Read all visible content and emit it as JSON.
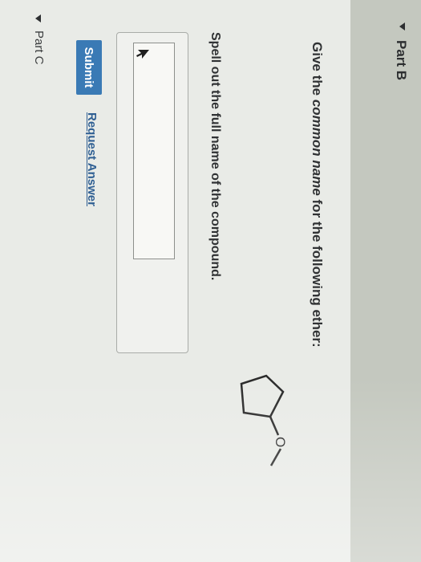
{
  "part_b": {
    "title": "Part B"
  },
  "question": {
    "prefix": "Give the ",
    "emphasis": "common name",
    "suffix": " for the following ether:"
  },
  "molecule": {
    "oxygen_label": "O"
  },
  "instruction": "Spell out the full name of the compound.",
  "answer": {
    "value": "",
    "placeholder": ""
  },
  "actions": {
    "submit_label": "Submit",
    "request_answer_label": "Request Answer"
  },
  "part_c": {
    "title": "Part C"
  },
  "colors": {
    "submit_bg": "#3a7ab5",
    "link": "#2f5f93",
    "header_band": "#c4c8bf"
  }
}
